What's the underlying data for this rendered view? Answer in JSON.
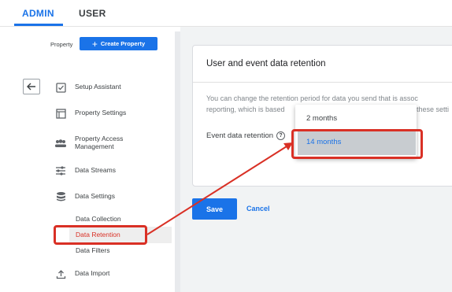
{
  "tabs": [
    {
      "label": "ADMIN",
      "active": true
    },
    {
      "label": "USER",
      "active": false
    }
  ],
  "property": {
    "label": "Property",
    "create_button": "Create Property"
  },
  "nav": {
    "items": [
      {
        "label": "Setup Assistant",
        "icon": "checkbox-icon"
      },
      {
        "label": "Property Settings",
        "icon": "square-icon"
      },
      {
        "label": "Property Access Management",
        "icon": "group-icon"
      },
      {
        "label": "Data Streams",
        "icon": "streams-icon"
      },
      {
        "label": "Data Settings",
        "icon": "database-icon"
      },
      {
        "label": "Data Import",
        "icon": "upload-icon"
      }
    ],
    "data_settings_subitems": [
      {
        "label": "Data Collection",
        "active": false
      },
      {
        "label": "Data Retention",
        "active": true
      },
      {
        "label": "Data Filters",
        "active": false
      }
    ]
  },
  "card": {
    "title": "User and event data retention",
    "description_line1": "You can change the retention period for data you send that is assoc",
    "description_line2": "reporting, which is based",
    "description_line2_tail": "these setti",
    "field_label": "Event data retention",
    "help_glyph": "?"
  },
  "dropdown": {
    "options": [
      "2 months",
      "14 months"
    ],
    "selected": "14 months"
  },
  "actions": {
    "save": "Save",
    "cancel": "Cancel"
  },
  "colors": {
    "accent": "#1a73e8",
    "highlight": "#d93025"
  }
}
